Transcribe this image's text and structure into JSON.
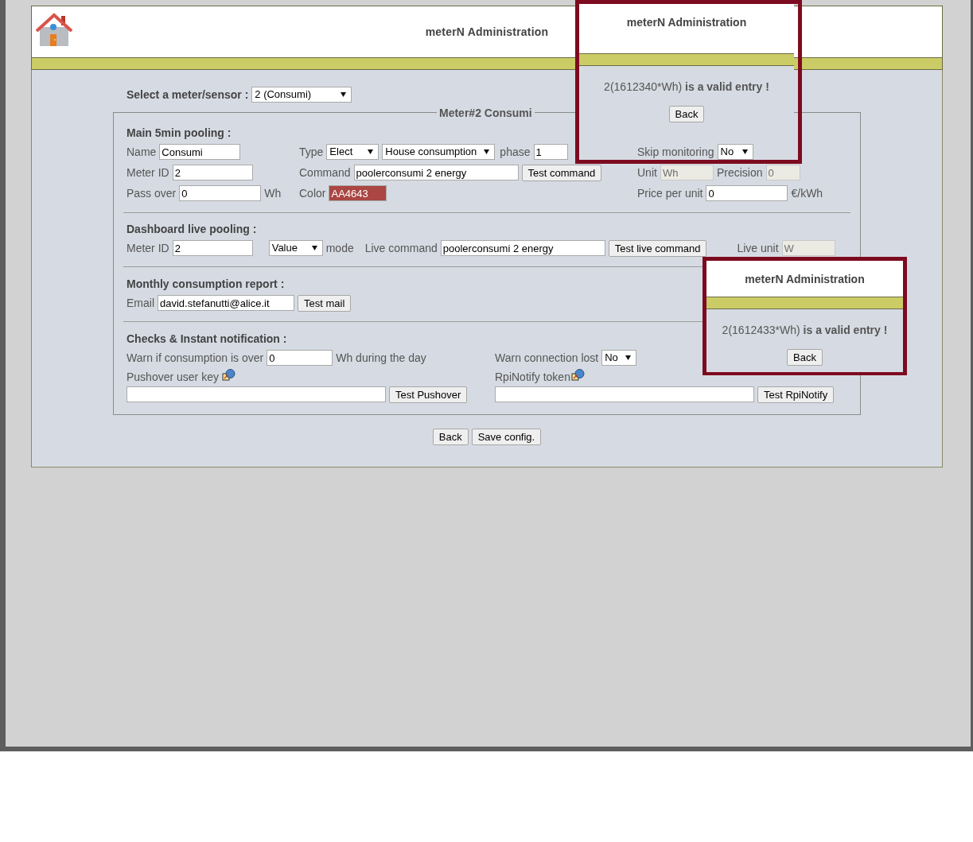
{
  "header": {
    "title": "meterN Administration"
  },
  "meter_select": {
    "label": "Select a meter/sensor :",
    "value": "2 (Consumi)"
  },
  "fieldset": {
    "legend": "Meter#2 Consumi",
    "main": {
      "heading": "Main 5min pooling :",
      "name": {
        "label": "Name",
        "value": "Consumi"
      },
      "meter_id": {
        "label": "Meter ID",
        "value": "2"
      },
      "pass_over": {
        "label": "Pass over",
        "value": "0",
        "unit": "Wh"
      },
      "type": {
        "label": "Type",
        "value": "Elect"
      },
      "type_detail": {
        "value": "House consumption"
      },
      "phase": {
        "label": "phase",
        "value": "1"
      },
      "command": {
        "label": "Command",
        "value": "poolerconsumi 2 energy",
        "button": "Test command"
      },
      "color": {
        "label": "Color",
        "value": "AA4643"
      },
      "skip": {
        "label": "Skip monitoring",
        "value": "No"
      },
      "unit": {
        "label": "Unit",
        "value": "Wh",
        "disabled": true
      },
      "precision": {
        "label": "Precision",
        "value": "0",
        "disabled": true
      },
      "price": {
        "label": "Price per unit",
        "value": "0",
        "unit": "€/kWh"
      }
    },
    "dashboard": {
      "heading": "Dashboard live pooling :",
      "meter_id": {
        "label": "Meter ID",
        "value": "2"
      },
      "mode": {
        "value": "Value",
        "label": "mode"
      },
      "live_command": {
        "label": "Live command",
        "value": "poolerconsumi 2 energy",
        "button": "Test live command"
      },
      "live_unit": {
        "label": "Live unit",
        "value": "W",
        "disabled": true
      }
    },
    "monthly": {
      "heading": "Monthly consumption report :",
      "email": {
        "label": "Email",
        "value": "david.stefanutti@alice.it",
        "button": "Test mail"
      }
    },
    "checks": {
      "heading": "Checks & Instant notification :",
      "warn_consumption": {
        "label": "Warn if consumption is over",
        "value": "0",
        "suffix": "Wh during the day"
      },
      "warn_connection": {
        "label": "Warn connection lost",
        "value": "No"
      },
      "pushover": {
        "label": "Pushover user key",
        "button": "Test Pushover"
      },
      "rpinotify": {
        "label": "RpiNotify token",
        "button": "Test RpiNotify"
      }
    }
  },
  "actions": [
    "Back",
    "Save config."
  ],
  "popups": [
    {
      "title": "meterN Administration",
      "message": "2(1612340*Wh) **is a valid entry !**",
      "button": "Back"
    },
    {
      "title": "meterN Administration",
      "message": "2(1612433*Wh) **is a valid entry !**",
      "button": "Back"
    }
  ]
}
